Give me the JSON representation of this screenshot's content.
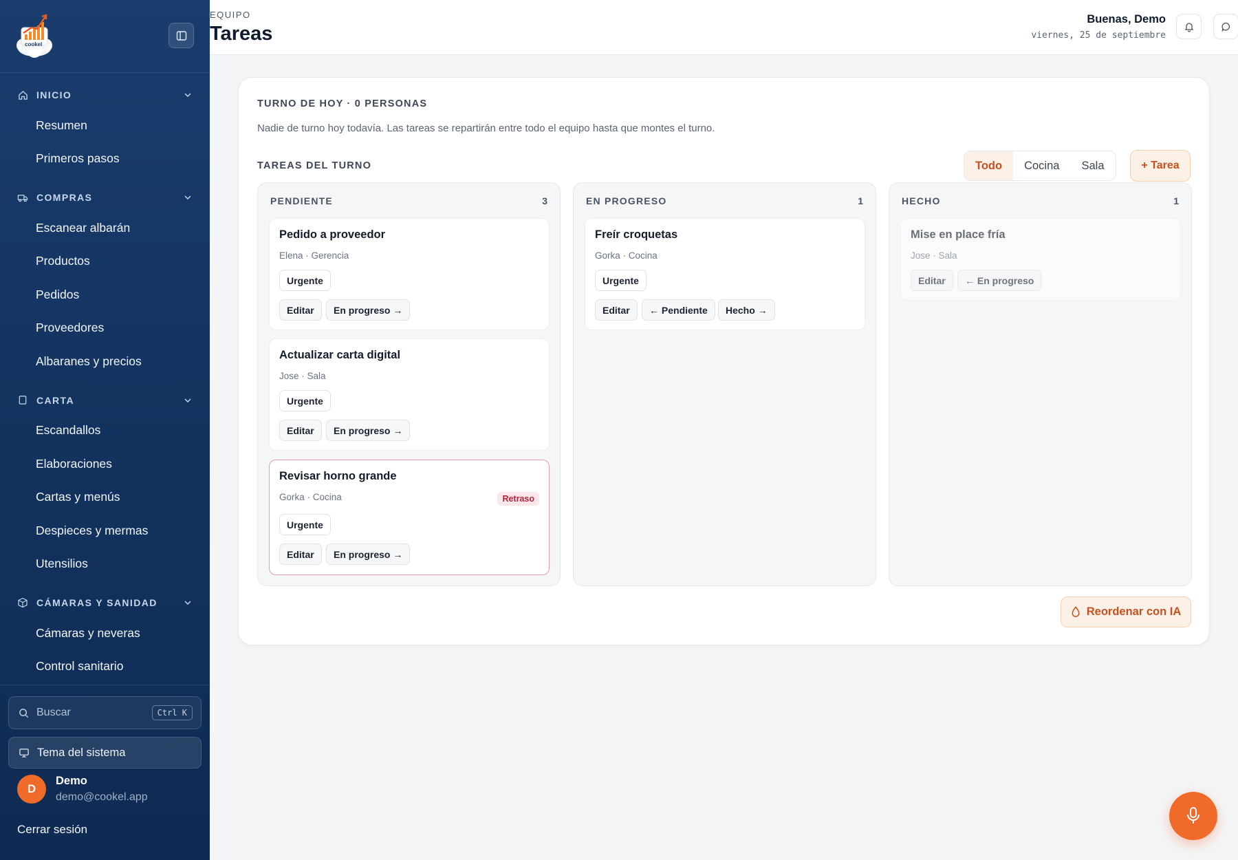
{
  "sidebar": {
    "logo_text": "cookel",
    "sections": [
      {
        "label": "INICIO",
        "icon": "home-icon",
        "items": [
          "Resumen",
          "Primeros pasos"
        ]
      },
      {
        "label": "COMPRAS",
        "icon": "truck-icon",
        "items": [
          "Escanear albarán",
          "Productos",
          "Pedidos",
          "Proveedores",
          "Albaranes y precios"
        ]
      },
      {
        "label": "CARTA",
        "icon": "book-icon",
        "items": [
          "Escandallos",
          "Elaboraciones",
          "Cartas y menús",
          "Despieces y mermas",
          "Utensilios"
        ]
      },
      {
        "label": "CÁMARAS Y SANIDAD",
        "icon": "box-icon",
        "items": [
          "Cámaras y neveras",
          "Control sanitario"
        ]
      }
    ],
    "search_placeholder": "Buscar",
    "search_shortcut": "Ctrl K",
    "theme_label": "Tema del sistema",
    "user": {
      "initial": "D",
      "name": "Demo",
      "email": "demo@cookel.app"
    },
    "logout_label": "Cerrar sesión"
  },
  "header": {
    "eyebrow": "EQUIPO",
    "title": "Tareas",
    "greeting": "Buenas, Demo",
    "date": "viernes, 25 de septiembre"
  },
  "main": {
    "turno_title": "TURNO DE HOY · 0 PERSONAS",
    "turno_desc": "Nadie de turno hoy todavía. Las tareas se repartirán entre todo el equipo hasta que montes el turno.",
    "tareas_title": "TAREAS DEL TURNO",
    "filters": [
      {
        "label": "Todo",
        "active": true
      },
      {
        "label": "Cocina",
        "active": false
      },
      {
        "label": "Sala",
        "active": false
      }
    ],
    "add_task_label": "+ Tarea",
    "reorder_label": "Reordenar con IA",
    "colors": {
      "accent": "#f06a2a",
      "accent_text": "#c4511e",
      "sidebar": "#13335f",
      "late": "#b2243b"
    },
    "columns": [
      {
        "title": "PENDIENTE",
        "count": "3",
        "tasks": [
          {
            "title": "Pedido a proveedor",
            "meta": "Elena · Gerencia",
            "tag": "Urgente",
            "late": "",
            "actions": [
              "Editar",
              "En progreso →"
            ]
          },
          {
            "title": "Actualizar carta digital",
            "meta": "Jose · Sala",
            "tag": "Urgente",
            "late": "",
            "actions": [
              "Editar",
              "En progreso →"
            ]
          },
          {
            "title": "Revisar horno grande",
            "meta": "Gorka · Cocina",
            "tag": "Urgente",
            "late": "Retraso",
            "actions": [
              "Editar",
              "En progreso →"
            ]
          }
        ]
      },
      {
        "title": "EN PROGRESO",
        "count": "1",
        "tasks": [
          {
            "title": "Freír croquetas",
            "meta": "Gorka · Cocina",
            "tag": "Urgente",
            "late": "",
            "actions": [
              "Editar",
              "← Pendiente",
              "Hecho →"
            ]
          }
        ]
      },
      {
        "title": "HECHO",
        "count": "1",
        "tasks": [
          {
            "title": "Mise en place fría",
            "meta": "Jose · Sala",
            "tag": "",
            "late": "",
            "actions": [
              "Editar",
              "← En progreso"
            ]
          }
        ]
      }
    ]
  }
}
